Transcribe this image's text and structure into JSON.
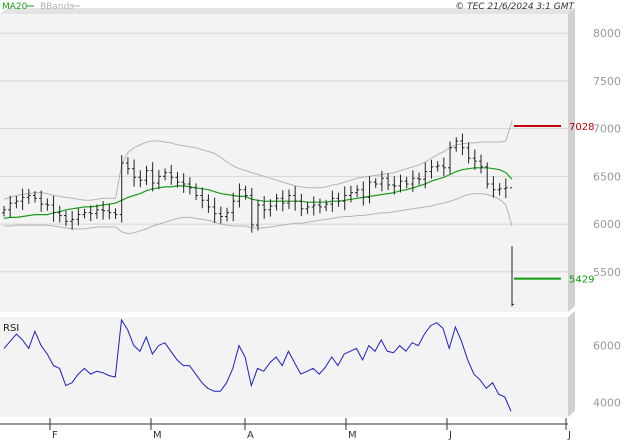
{
  "header": {
    "legend": [
      {
        "label": "MA20",
        "color": "#1a9c1a"
      },
      {
        "label": "BBands",
        "color": "#b4b4b4"
      }
    ],
    "copyright": "© TEC 21/6/2024 3:1 GMT"
  },
  "colors": {
    "ohlc": "#222222",
    "ma20": "#1a9c1a",
    "bbands": "#b4b4b4",
    "rsi": "#1f1fbf",
    "resistance": "#c0000a",
    "support": "#0a9c0a",
    "panel_bg": "#f3f3f3",
    "grid": "#d6d6d6",
    "axis_text": "#9a9a9a"
  },
  "chart_data": [
    {
      "type": "ohlc",
      "panel": "price",
      "title": "",
      "ylim": [
        5080,
        8200
      ],
      "yticks": [
        8000,
        7500,
        7000,
        6500,
        6000,
        5500
      ],
      "x_labels": [
        "F",
        "M",
        "A",
        "M",
        "J",
        "J"
      ],
      "grid": true,
      "levels": [
        {
          "label": "7028",
          "value": 7028,
          "kind": "resistance"
        },
        {
          "label": "5429",
          "value": 5429,
          "kind": "support"
        }
      ],
      "close": [
        6150,
        6220,
        6240,
        6280,
        6300,
        6270,
        6210,
        6200,
        6120,
        6090,
        6030,
        6050,
        6100,
        6120,
        6110,
        6150,
        6140,
        6120,
        6100,
        6640,
        6580,
        6490,
        6460,
        6560,
        6430,
        6500,
        6540,
        6490,
        6440,
        6420,
        6380,
        6300,
        6250,
        6180,
        6110,
        6080,
        6120,
        6240,
        6360,
        6300,
        5990,
        6200,
        6150,
        6190,
        6270,
        6220,
        6300,
        6240,
        6160,
        6180,
        6200,
        6180,
        6210,
        6270,
        6240,
        6300,
        6330,
        6360,
        6280,
        6440,
        6420,
        6480,
        6410,
        6400,
        6450,
        6420,
        6480,
        6470,
        6550,
        6600,
        6610,
        6590,
        6800,
        6870,
        6800,
        6690,
        6660,
        6600,
        6420,
        6360,
        6370,
        6380,
        5160
      ],
      "ma20": [
        6060,
        6070,
        6070,
        6080,
        6090,
        6100,
        6100,
        6100,
        6120,
        6130,
        6150,
        6160,
        6170,
        6180,
        6180,
        6190,
        6200,
        6210,
        6220,
        6250,
        6280,
        6300,
        6320,
        6350,
        6370,
        6380,
        6390,
        6390,
        6400,
        6400,
        6390,
        6380,
        6370,
        6360,
        6340,
        6320,
        6310,
        6300,
        6290,
        6290,
        6260,
        6250,
        6240,
        6240,
        6240,
        6240,
        6240,
        6240,
        6240,
        6230,
        6230,
        6230,
        6230,
        6240,
        6240,
        6250,
        6260,
        6270,
        6280,
        6290,
        6300,
        6310,
        6320,
        6330,
        6350,
        6360,
        6380,
        6400,
        6420,
        6450,
        6470,
        6490,
        6520,
        6550,
        6570,
        6580,
        6590,
        6590,
        6590,
        6580,
        6570,
        6540,
        6470
      ],
      "bb_upper": [
        6260,
        6280,
        6300,
        6310,
        6320,
        6330,
        6330,
        6320,
        6300,
        6290,
        6280,
        6270,
        6260,
        6250,
        6250,
        6260,
        6270,
        6270,
        6270,
        6620,
        6750,
        6800,
        6830,
        6860,
        6870,
        6870,
        6860,
        6850,
        6830,
        6820,
        6810,
        6800,
        6780,
        6760,
        6740,
        6700,
        6650,
        6610,
        6580,
        6560,
        6540,
        6520,
        6500,
        6480,
        6460,
        6440,
        6420,
        6400,
        6390,
        6380,
        6380,
        6380,
        6390,
        6410,
        6420,
        6440,
        6460,
        6480,
        6490,
        6500,
        6510,
        6520,
        6530,
        6540,
        6560,
        6580,
        6600,
        6620,
        6650,
        6690,
        6730,
        6760,
        6800,
        6830,
        6840,
        6850,
        6850,
        6860,
        6860,
        6860,
        6860,
        6870,
        7080
      ],
      "bb_lower": [
        5980,
        5980,
        5990,
        5990,
        5990,
        5990,
        5990,
        5990,
        5980,
        5970,
        5960,
        5950,
        5950,
        5950,
        5960,
        5970,
        5970,
        5970,
        5970,
        5920,
        5900,
        5910,
        5930,
        5950,
        5980,
        6000,
        6020,
        6040,
        6060,
        6070,
        6070,
        6060,
        6050,
        6040,
        6020,
        6000,
        5990,
        5980,
        5980,
        5980,
        5960,
        5960,
        5960,
        5970,
        5980,
        5990,
        6000,
        6010,
        6010,
        6020,
        6030,
        6040,
        6050,
        6060,
        6070,
        6080,
        6080,
        6090,
        6090,
        6100,
        6110,
        6120,
        6120,
        6130,
        6140,
        6150,
        6160,
        6170,
        6180,
        6190,
        6210,
        6220,
        6240,
        6260,
        6290,
        6310,
        6320,
        6320,
        6310,
        6290,
        6260,
        6200,
        5980
      ]
    },
    {
      "type": "line",
      "panel": "rsi",
      "title": "RSI",
      "ylim": [
        3500,
        7000
      ],
      "yticks": [
        6000,
        4000
      ],
      "grid": false,
      "values": [
        5900,
        6150,
        6400,
        6200,
        5900,
        6500,
        6000,
        5700,
        5300,
        5200,
        4600,
        4700,
        5000,
        5200,
        5000,
        5100,
        5050,
        4950,
        4900,
        6900,
        6550,
        6000,
        5800,
        6300,
        5700,
        6000,
        6100,
        5800,
        5500,
        5300,
        5300,
        5000,
        4700,
        4500,
        4400,
        4400,
        4700,
        5200,
        6000,
        5600,
        4600,
        5200,
        5100,
        5400,
        5600,
        5300,
        5800,
        5400,
        5000,
        5100,
        5200,
        5000,
        5250,
        5600,
        5300,
        5700,
        5800,
        5900,
        5500,
        6000,
        5800,
        6200,
        5800,
        5750,
        6000,
        5800,
        6100,
        6000,
        6400,
        6700,
        6800,
        6600,
        5900,
        6650,
        6150,
        5500,
        5000,
        4800,
        4500,
        4700,
        4300,
        4200,
        3700
      ]
    }
  ]
}
